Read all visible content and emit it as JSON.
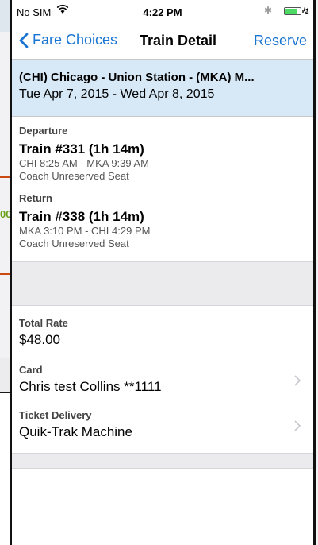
{
  "background": {
    "partial_number": "00"
  },
  "status_bar": {
    "carrier": "No SIM",
    "time": "4:22 PM",
    "bluetooth_icon": "bluetooth-icon",
    "wifi_icon": "wifi-icon",
    "battery_icon": "battery-icon",
    "charging_icon": "charging-bolt-icon"
  },
  "nav": {
    "back_label": "Fare Choices",
    "title": "Train Detail",
    "action_label": "Reserve",
    "accent_color": "#1a74d2"
  },
  "route": {
    "title": "(CHI) Chicago - Union Station - (MKA) M...",
    "dates": "Tue Apr 7, 2015 - Wed Apr 8, 2015",
    "banner_color": "#d7e9f7"
  },
  "departure": {
    "label": "Departure",
    "train": "Train #331 (1h 14m)",
    "times": "CHI 8:25 AM - MKA 9:39 AM",
    "seat": "Coach Unreserved Seat"
  },
  "return_trip": {
    "label": "Return",
    "train": "Train #338 (1h 14m)",
    "times": "MKA 3:10 PM - CHI 4:29 PM",
    "seat": "Coach Unreserved Seat"
  },
  "summary": {
    "total_label": "Total Rate",
    "total_value": "$48.00",
    "card_label": "Card",
    "card_value": "Chris test Collins **1111",
    "delivery_label": "Ticket Delivery",
    "delivery_value": "Quik-Trak Machine"
  }
}
